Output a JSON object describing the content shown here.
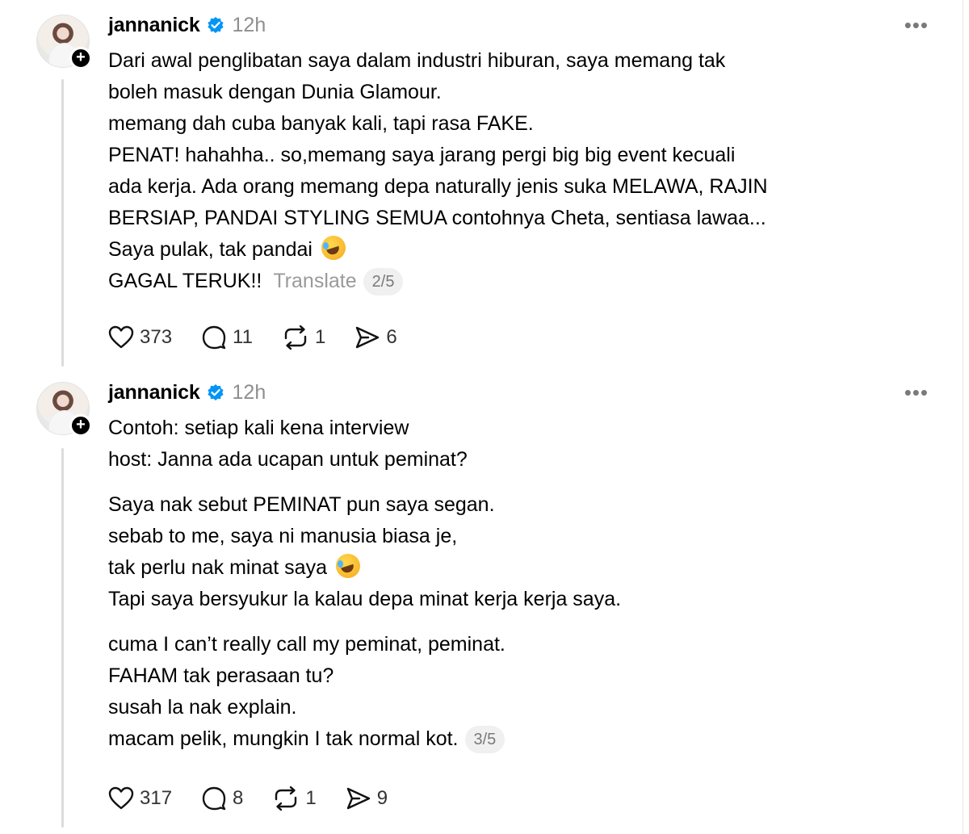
{
  "posts": [
    {
      "username": "jannanick",
      "time": "12h",
      "more": "•••",
      "lines": [
        "Dari awal penglibatan saya dalam industri hiburan, saya memang tak",
        "boleh masuk dengan Dunia Glamour.",
        "memang dah cuba banyak kali, tapi rasa FAKE.",
        "PENAT! hahahha.. so,memang saya jarang pergi big big event kecuali",
        "ada kerja. Ada orang memang depa naturally jenis suka MELAWA, RAJIN",
        "BERSIAP, PANDAI STYLING SEMUA contohnya Cheta, sentiasa lawaa...",
        "Saya pulak, tak pandai"
      ],
      "last_line": "GAGAL TERUK!!",
      "translate_label": "Translate",
      "page_indicator": "2/5",
      "likes": "373",
      "replies": "11",
      "reposts": "1",
      "shares": "6"
    },
    {
      "username": "jannanick",
      "time": "12h",
      "more": "•••",
      "paragraph1": [
        "Contoh: setiap kali kena interview",
        "host: Janna ada ucapan untuk peminat?"
      ],
      "paragraph2": [
        "Saya nak sebut PEMINAT pun saya segan.",
        "sebab to me, saya ni manusia biasa je,",
        "tak perlu nak minat saya",
        "Tapi saya bersyukur la kalau depa minat kerja kerja saya."
      ],
      "paragraph3": [
        "cuma I can’t really call my peminat, peminat.",
        "FAHAM tak perasaan tu?",
        "susah la nak explain."
      ],
      "last_line": "macam pelik, mungkin I tak normal kot.",
      "page_indicator": "3/5",
      "likes": "317",
      "replies": "8",
      "reposts": "1",
      "shares": "9"
    }
  ],
  "colors": {
    "verified": "#0095f6",
    "muted": "#8e8e8e",
    "thread_line": "#dcdcdc"
  },
  "icons": [
    "heart-icon",
    "reply-icon",
    "repost-icon",
    "share-icon",
    "verified-badge-icon",
    "rofl-emoji-icon",
    "follow-plus-icon",
    "more-options-icon"
  ]
}
